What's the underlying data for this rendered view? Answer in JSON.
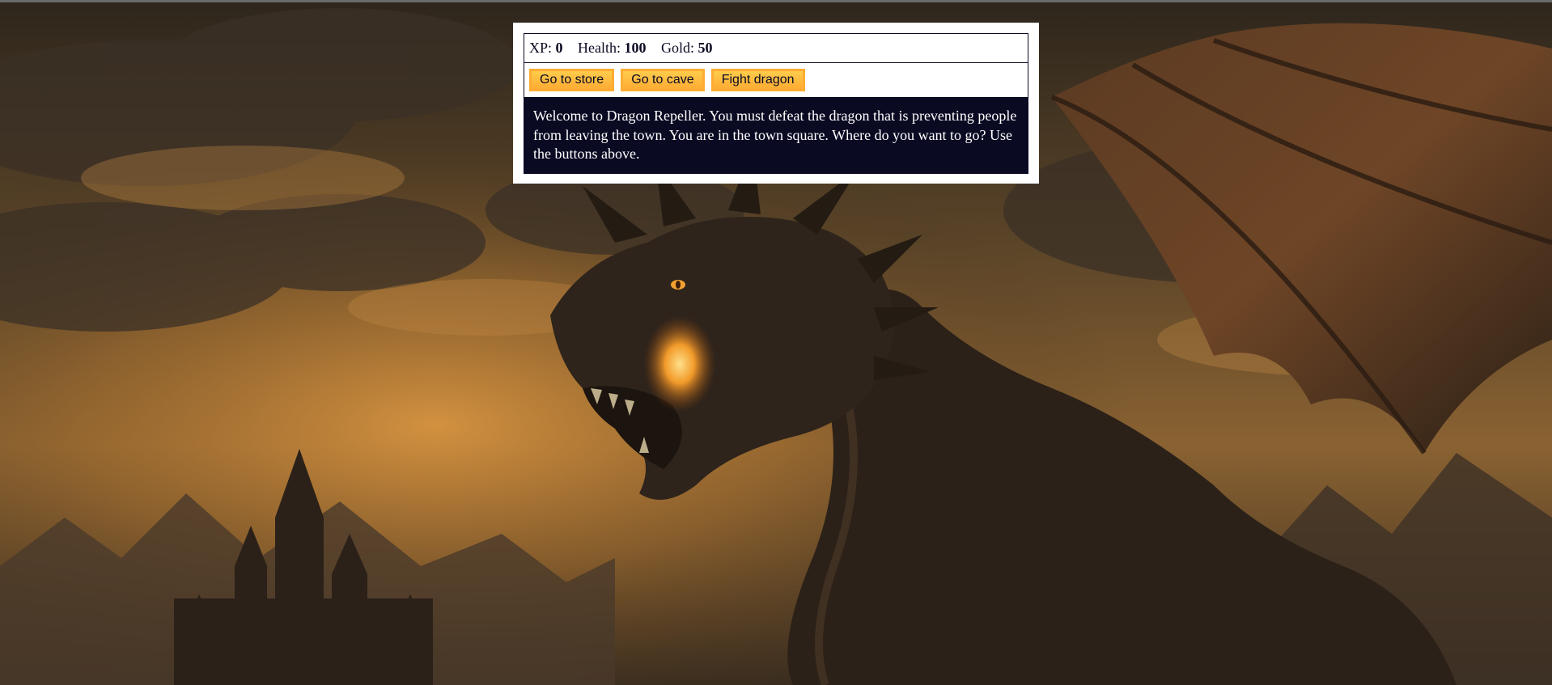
{
  "stats": {
    "xp_label": "XP:",
    "xp_value": "0",
    "health_label": "Health:",
    "health_value": "100",
    "gold_label": "Gold:",
    "gold_value": "50"
  },
  "controls": {
    "button1": "Go to store",
    "button2": "Go to cave",
    "button3": "Fight dragon"
  },
  "text": {
    "message": "Welcome to Dragon Repeller. You must defeat the dragon that is preventing people from leaving the town. You are in the town square. Where do you want to go? Use the buttons above."
  },
  "colors": {
    "button": "#feac32",
    "text_panel": "#0a0a23",
    "window": "#ffffff"
  }
}
